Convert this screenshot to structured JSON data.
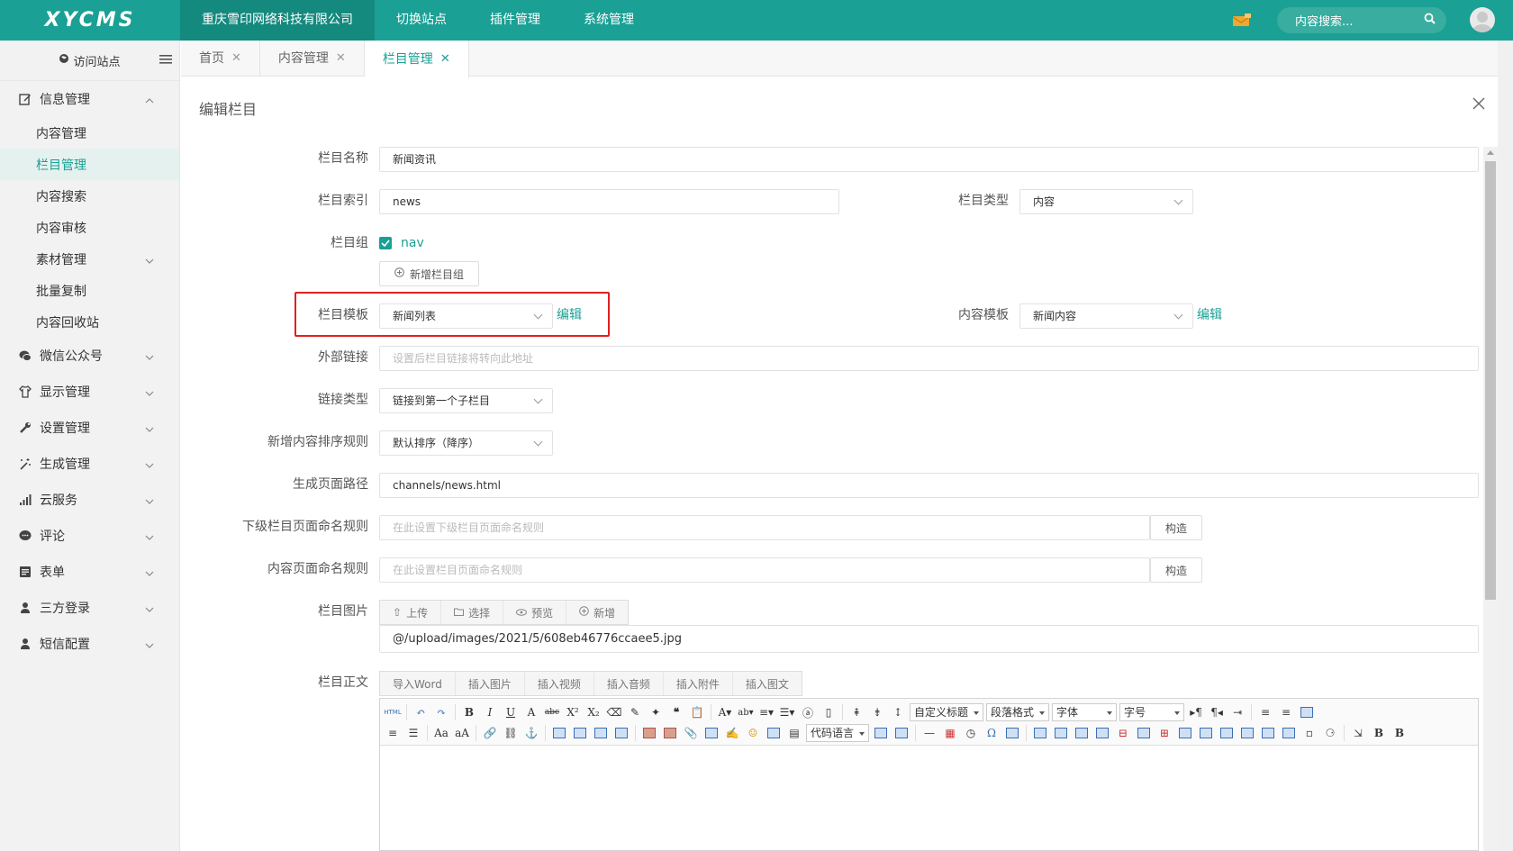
{
  "header": {
    "logo": "XYCMS",
    "nav": [
      "重庆雪印网络科技有限公司",
      "切换站点",
      "插件管理",
      "系统管理"
    ],
    "search_placeholder": "内容搜索..."
  },
  "sidebar": {
    "visit": "访问站点",
    "groups": [
      {
        "label": "信息管理",
        "icon": "edit-icon",
        "expanded": true
      },
      {
        "label": "微信公众号",
        "icon": "wechat-icon"
      },
      {
        "label": "显示管理",
        "icon": "shirt-icon"
      },
      {
        "label": "设置管理",
        "icon": "wrench-icon"
      },
      {
        "label": "生成管理",
        "icon": "magic-wand-icon"
      },
      {
        "label": "云服务",
        "icon": "signal-icon"
      },
      {
        "label": "评论",
        "icon": "comment-icon"
      },
      {
        "label": "表单",
        "icon": "form-icon"
      },
      {
        "label": "三方登录",
        "icon": "user-icon"
      },
      {
        "label": "短信配置",
        "icon": "user-icon"
      }
    ],
    "subitems": [
      "内容管理",
      "栏目管理",
      "内容搜索",
      "内容审核",
      "素材管理",
      "批量复制",
      "内容回收站"
    ]
  },
  "tabs": [
    {
      "label": "首页"
    },
    {
      "label": "内容管理"
    },
    {
      "label": "栏目管理",
      "active": true
    }
  ],
  "panel": {
    "title": "编辑栏目",
    "fields": {
      "name": {
        "label": "栏目名称",
        "value": "新闻资讯"
      },
      "index": {
        "label": "栏目索引",
        "value": "news"
      },
      "type": {
        "label": "栏目类型",
        "value": "内容"
      },
      "group": {
        "label": "栏目组",
        "checked_value": "nav",
        "add_button": "新增栏目组"
      },
      "channel_template": {
        "label": "栏目模板",
        "value": "新闻列表",
        "edit": "编辑"
      },
      "content_template": {
        "label": "内容模板",
        "value": "新闻内容",
        "edit": "编辑"
      },
      "external_link": {
        "label": "外部链接",
        "placeholder": "设置后栏目链接将转向此地址"
      },
      "link_type": {
        "label": "链接类型",
        "value": "链接到第一个子栏目"
      },
      "sort_rule": {
        "label": "新增内容排序规则",
        "value": "默认排序（降序）"
      },
      "page_path": {
        "label": "生成页面路径",
        "value": "channels/news.html"
      },
      "sub_naming": {
        "label": "下级栏目页面命名规则",
        "placeholder": "在此设置下级栏目页面命名规则",
        "build": "构造"
      },
      "content_naming": {
        "label": "内容页面命名规则",
        "placeholder": "在此设置栏目页面命名规则",
        "build": "构造"
      },
      "image": {
        "label": "栏目图片",
        "buttons": [
          "上传",
          "选择",
          "预览",
          "新增"
        ],
        "value": "@/upload/images/2021/5/608eb46776ccaee5.jpg"
      },
      "body": {
        "label": "栏目正文",
        "buttons": [
          "导入Word",
          "插入图片",
          "插入视频",
          "插入音频",
          "插入附件",
          "插入图文"
        ]
      }
    },
    "editor": {
      "html_label": "HTML",
      "selects": [
        "自定义标题",
        "段落格式",
        "字体",
        "字号"
      ],
      "code_select": "代码语言"
    }
  },
  "colors": {
    "brand": "#1aa094",
    "highlight": "#e02020"
  }
}
